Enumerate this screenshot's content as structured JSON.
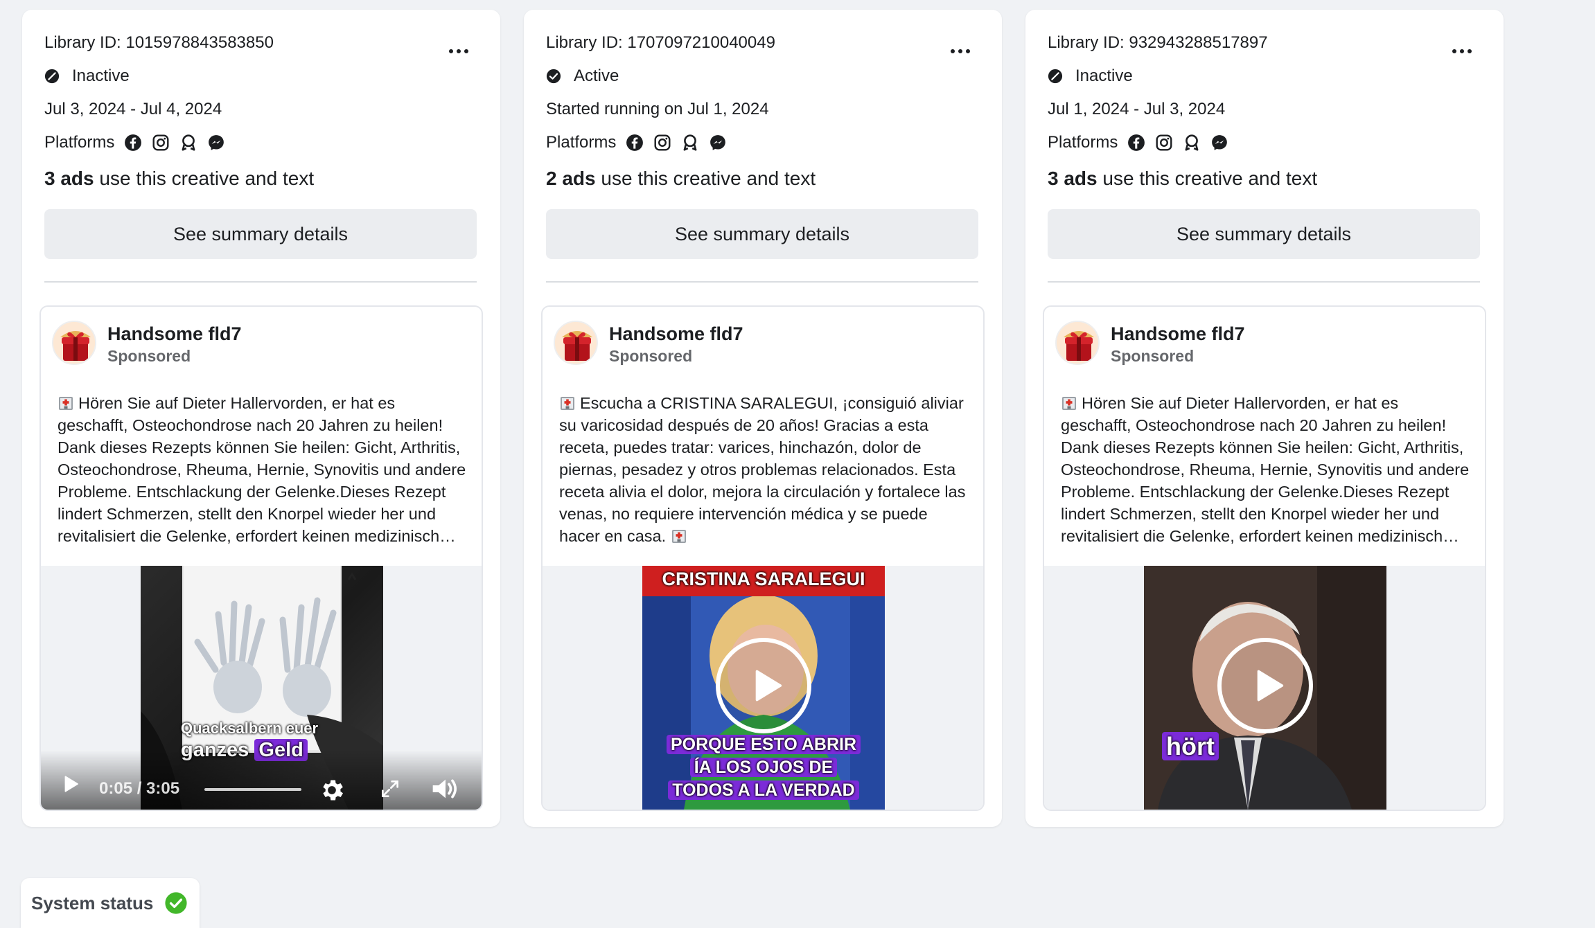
{
  "colors": {
    "page_bg": "#f0f2f5",
    "card_bg": "#ffffff",
    "button_bg": "#ebedf0",
    "caption_highlight": "#7b2bd8",
    "system_ok": "#42b72a"
  },
  "cards": [
    {
      "library_id": "Library ID: 1015978843583850",
      "status": "Inactive",
      "dates": "Jul 3, 2024 - Jul 4, 2024",
      "platforms_label": "Platforms",
      "platforms": [
        "facebook-icon",
        "instagram-icon",
        "audience-network-icon",
        "messenger-icon"
      ],
      "ads_count": "3 ads",
      "ads_count_suffix": " use this creative and text",
      "summary_button": "See summary details",
      "ad": {
        "page_name": "Handsome fld7",
        "sponsored": "Sponsored",
        "text": "Hören Sie auf Dieter Hallervorden, er hat es geschafft, Osteochondrose nach 20 Jahren zu heilen! Dank dieses Rezepts können Sie heilen: Gicht, Arthritis, Osteochondrose, Rheuma, Hernie, Synovitis und andere Probleme. Entschlackung der Gelenke.Dieses Rezept lindert Schmerzen, stellt den Knorpel wieder her und revitalisiert die Gelenke, erfordert keinen medizinisch…",
        "caption_line1": "Quacksalbern euer",
        "caption_line2a": "ganzes",
        "caption_line2b": "Geld",
        "time": "0:05 / 3:05"
      }
    },
    {
      "library_id": "Library ID: 1707097210040049",
      "status": "Active",
      "dates": "Started running on Jul 1, 2024",
      "platforms_label": "Platforms",
      "platforms": [
        "facebook-icon",
        "instagram-icon",
        "audience-network-icon",
        "messenger-icon"
      ],
      "ads_count": "2 ads",
      "ads_count_suffix": " use this creative and text",
      "summary_button": "See summary details",
      "ad": {
        "page_name": "Handsome fld7",
        "sponsored": "Sponsored",
        "text": "Escucha a CRISTINA SARALEGUI, ¡consiguió aliviar su varicosidad después de 20 años! Gracias a esta receta, puedes tratar: varices, hinchazón, dolor de piernas, pesadez y otros problemas relacionados. Esta receta alivia el dolor, mejora la circulación y fortalece las venas, no requiere intervención médica y se puede hacer en casa.",
        "banner": "CRISTINA SARALEGUI",
        "caption_line1": "PORQUE ESTO ABRIR",
        "caption_line2": "ÍA LOS OJOS DE",
        "caption_line3": "TODOS A LA VERDAD"
      }
    },
    {
      "library_id": "Library ID: 932943288517897",
      "status": "Inactive",
      "dates": "Jul 1, 2024 - Jul 3, 2024",
      "platforms_label": "Platforms",
      "platforms": [
        "facebook-icon",
        "instagram-icon",
        "audience-network-icon",
        "messenger-icon"
      ],
      "ads_count": "3 ads",
      "ads_count_suffix": " use this creative and text",
      "summary_button": "See summary details",
      "ad": {
        "page_name": "Handsome fld7",
        "sponsored": "Sponsored",
        "text": "Hören Sie auf Dieter Hallervorden, er hat es geschafft, Osteochondrose nach 20 Jahren zu heilen! Dank dieses Rezepts können Sie heilen: Gicht, Arthritis, Osteochondrose, Rheuma, Hernie, Synovitis und andere Probleme. Entschlackung der Gelenke.Dieses Rezept lindert Schmerzen, stellt den Knorpel wieder her und revitalisiert die Gelenke, erfordert keinen medizinisch…",
        "caption": "hört"
      }
    }
  ],
  "system_status": {
    "label": "System status",
    "icon": "check-circle-icon"
  }
}
